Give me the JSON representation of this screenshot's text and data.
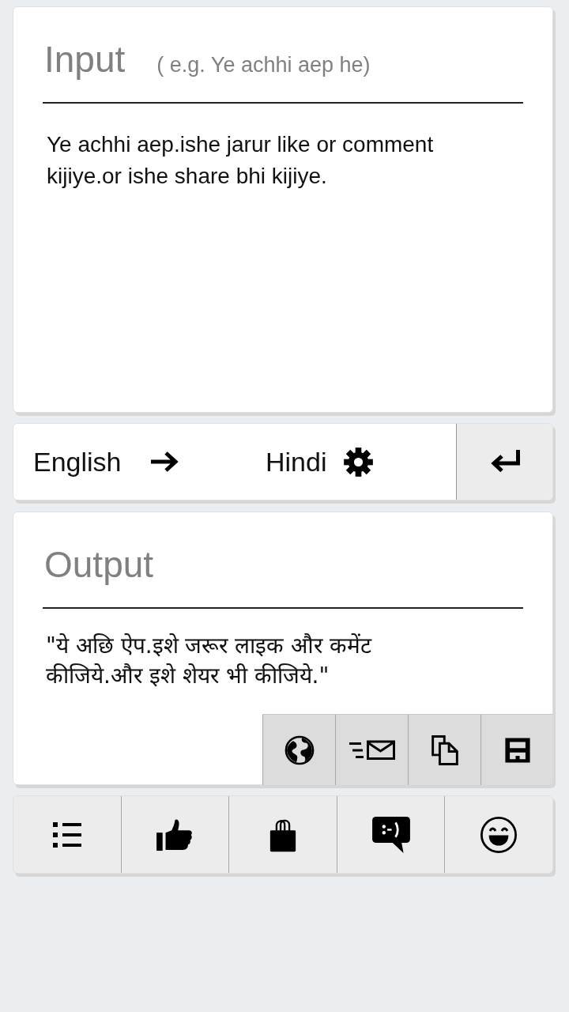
{
  "input": {
    "title": "Input",
    "hint": "( e.g. Ye achhi aep he)",
    "value": "Ye achhi aep.ishe jarur like or comment kijiye.or ishe share bhi kijiye."
  },
  "language_bar": {
    "source_language": "English",
    "target_language": "Hindi"
  },
  "output": {
    "title": "Output",
    "text": "\"ये अछि ऐप.इशे जरूर लाइक और कमेंट कीजिये.और इशे शेयर भी कीजिये.\""
  }
}
